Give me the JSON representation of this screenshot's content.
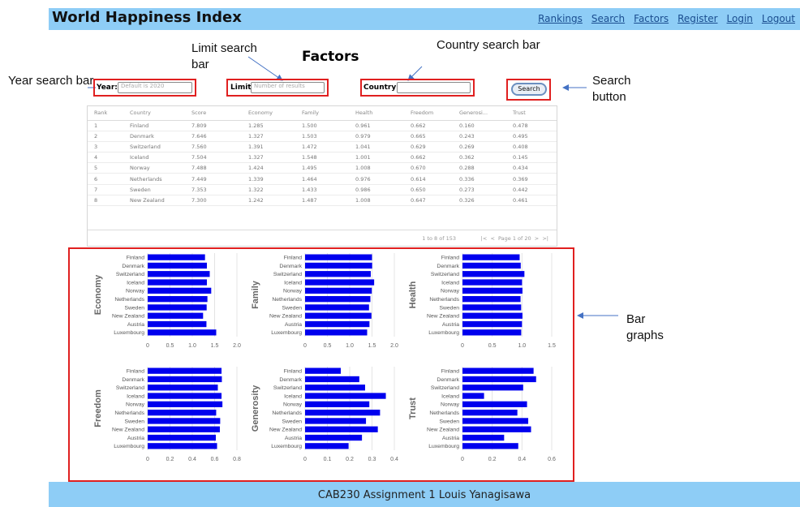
{
  "navbar": {
    "brand": "World Happiness Index",
    "links": [
      "Rankings",
      "Search",
      "Factors",
      "Register",
      "Login",
      "Logout"
    ]
  },
  "heading": "Factors",
  "annotations": {
    "year": "Year search bar",
    "limit": "Limit search bar",
    "country": "Country search bar",
    "search_button": "Search button",
    "bar_graphs": "Bar graphs"
  },
  "search": {
    "year_label": "Year:",
    "year_placeholder": "Default is 2020",
    "limit_label": "Limit:",
    "limit_placeholder": "Number of results",
    "country_label": "Country:",
    "country_placeholder": "",
    "button": "Search"
  },
  "table": {
    "columns": [
      "Rank",
      "Country",
      "Score",
      "Economy",
      "Family",
      "Health",
      "Freedom",
      "Generosi...",
      "Trust"
    ],
    "rows": [
      [
        "1",
        "Finland",
        "7.809",
        "1.285",
        "1.500",
        "0.961",
        "0.662",
        "0.160",
        "0.478"
      ],
      [
        "2",
        "Denmark",
        "7.646",
        "1.327",
        "1.503",
        "0.979",
        "0.665",
        "0.243",
        "0.495"
      ],
      [
        "3",
        "Switzerland",
        "7.560",
        "1.391",
        "1.472",
        "1.041",
        "0.629",
        "0.269",
        "0.408"
      ],
      [
        "4",
        "Iceland",
        "7.504",
        "1.327",
        "1.548",
        "1.001",
        "0.662",
        "0.362",
        "0.145"
      ],
      [
        "5",
        "Norway",
        "7.488",
        "1.424",
        "1.495",
        "1.008",
        "0.670",
        "0.288",
        "0.434"
      ],
      [
        "6",
        "Netherlands",
        "7.449",
        "1.339",
        "1.464",
        "0.976",
        "0.614",
        "0.336",
        "0.369"
      ],
      [
        "7",
        "Sweden",
        "7.353",
        "1.322",
        "1.433",
        "0.986",
        "0.650",
        "0.273",
        "0.442"
      ],
      [
        "8",
        "New Zealand",
        "7.300",
        "1.242",
        "1.487",
        "1.008",
        "0.647",
        "0.326",
        "0.461"
      ]
    ],
    "pager_info": "1 to 8 of 153",
    "pager_text": "Page 1 of 20"
  },
  "chart_data": [
    {
      "type": "bar",
      "title": "",
      "ylabel": "Economy",
      "categories": [
        "Finland",
        "Denmark",
        "Switzerland",
        "Iceland",
        "Norway",
        "Netherlands",
        "Sweden",
        "New Zealand",
        "Austria",
        "Luxembourg"
      ],
      "values": [
        1.285,
        1.327,
        1.391,
        1.327,
        1.424,
        1.339,
        1.322,
        1.242,
        1.317,
        1.536
      ],
      "xlim": [
        0,
        2.0
      ],
      "ticks": [
        "0",
        "0.5",
        "1.0",
        "1.5",
        "2.0"
      ],
      "color": "#0000ee"
    },
    {
      "type": "bar",
      "title": "",
      "ylabel": "Family",
      "categories": [
        "Finland",
        "Denmark",
        "Switzerland",
        "Iceland",
        "Norway",
        "Netherlands",
        "Sweden",
        "New Zealand",
        "Austria",
        "Luxembourg"
      ],
      "values": [
        1.5,
        1.503,
        1.472,
        1.548,
        1.495,
        1.464,
        1.433,
        1.487,
        1.443,
        1.391
      ],
      "xlim": [
        0,
        2.0
      ],
      "ticks": [
        "0",
        "0.5",
        "1.0",
        "1.5",
        "2.0"
      ],
      "color": "#0000ee"
    },
    {
      "type": "bar",
      "title": "",
      "ylabel": "Health",
      "categories": [
        "Finland",
        "Denmark",
        "Switzerland",
        "Iceland",
        "Norway",
        "Netherlands",
        "Sweden",
        "New Zealand",
        "Austria",
        "Luxembourg"
      ],
      "values": [
        0.961,
        0.979,
        1.041,
        1.001,
        1.008,
        0.976,
        0.986,
        1.008,
        1.0,
        0.987
      ],
      "xlim": [
        0,
        1.5
      ],
      "ticks": [
        "0",
        "0.5",
        "1.0",
        "1.5"
      ],
      "color": "#0000ee"
    },
    {
      "type": "bar",
      "title": "",
      "ylabel": "Freedom",
      "categories": [
        "Finland",
        "Denmark",
        "Switzerland",
        "Iceland",
        "Norway",
        "Netherlands",
        "Sweden",
        "New Zealand",
        "Austria",
        "Luxembourg"
      ],
      "values": [
        0.662,
        0.665,
        0.629,
        0.662,
        0.67,
        0.614,
        0.65,
        0.647,
        0.611,
        0.622
      ],
      "xlim": [
        0,
        0.8
      ],
      "ticks": [
        "0",
        "0.2",
        "0.4",
        "0.6",
        "0.8"
      ],
      "color": "#0000ee"
    },
    {
      "type": "bar",
      "title": "",
      "ylabel": "Generosity",
      "categories": [
        "Finland",
        "Denmark",
        "Switzerland",
        "Iceland",
        "Norway",
        "Netherlands",
        "Sweden",
        "New Zealand",
        "Austria",
        "Luxembourg"
      ],
      "values": [
        0.16,
        0.243,
        0.269,
        0.362,
        0.288,
        0.336,
        0.273,
        0.326,
        0.255,
        0.195
      ],
      "xlim": [
        0,
        0.4
      ],
      "ticks": [
        "0",
        "0.1",
        "0.2",
        "0.3",
        "0.4"
      ],
      "color": "#0000ee"
    },
    {
      "type": "bar",
      "title": "",
      "ylabel": "Trust",
      "categories": [
        "Finland",
        "Denmark",
        "Switzerland",
        "Iceland",
        "Norway",
        "Netherlands",
        "Sweden",
        "New Zealand",
        "Austria",
        "Luxembourg"
      ],
      "values": [
        0.478,
        0.495,
        0.408,
        0.145,
        0.434,
        0.369,
        0.442,
        0.461,
        0.28,
        0.375
      ],
      "xlim": [
        0,
        0.6
      ],
      "ticks": [
        "0",
        "0.2",
        "0.4",
        "0.6"
      ],
      "color": "#0000ee"
    }
  ],
  "footer": "CAB230 Assignment 1 Louis Yanagisawa"
}
